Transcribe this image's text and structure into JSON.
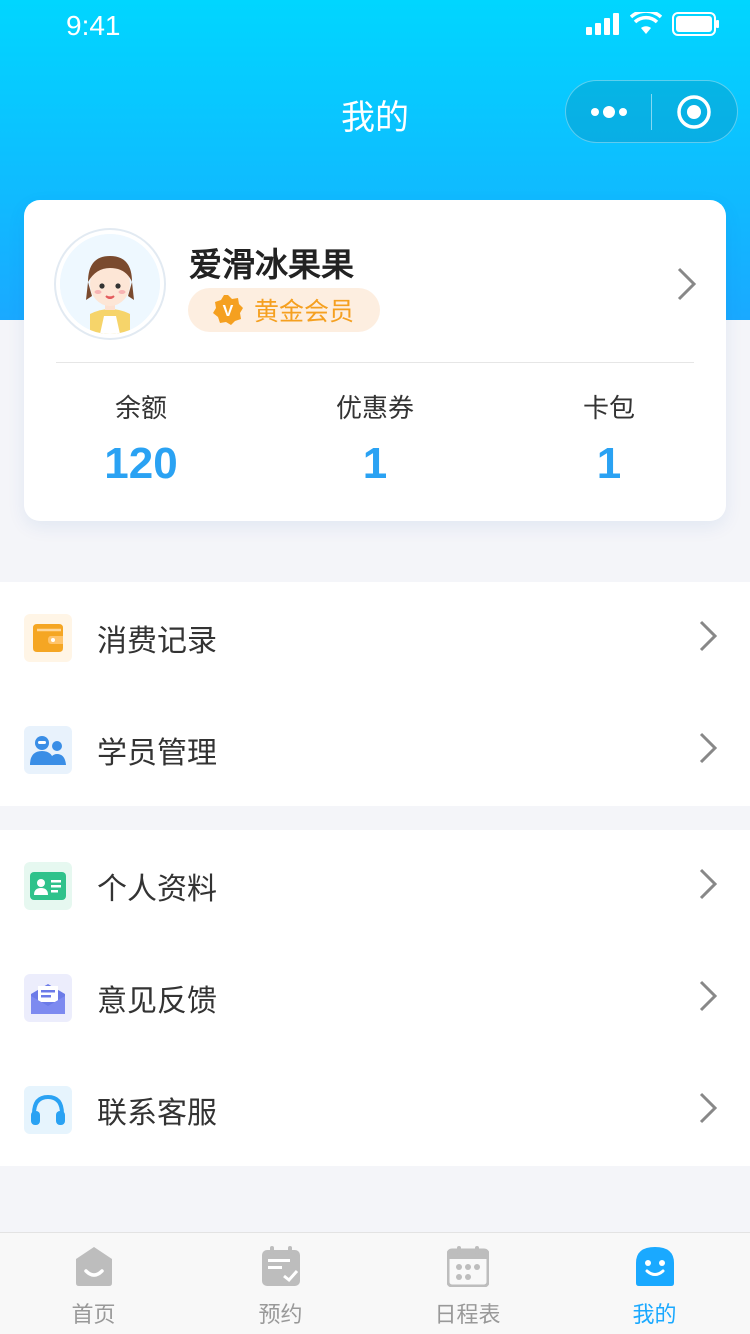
{
  "status_bar": {
    "time": "9:41"
  },
  "nav": {
    "title": "我的"
  },
  "profile": {
    "name": "爱滑冰果果",
    "vip_label": "黄金会员",
    "vip_mark": "V",
    "stats": [
      {
        "label": "余额",
        "value": "120"
      },
      {
        "label": "优惠券",
        "value": "1"
      },
      {
        "label": "卡包",
        "value": "1"
      }
    ]
  },
  "menu_group_1": [
    {
      "label": "消费记录",
      "icon": "wallet-icon",
      "color": "#f5a623"
    },
    {
      "label": "学员管理",
      "icon": "students-icon",
      "color": "#3a8ee6"
    }
  ],
  "menu_group_2": [
    {
      "label": "个人资料",
      "icon": "id-card-icon",
      "color": "#2fc28b"
    },
    {
      "label": "意见反馈",
      "icon": "feedback-mail-icon",
      "color": "#6c7be8"
    },
    {
      "label": "联系客服",
      "icon": "headset-icon",
      "color": "#2aa2f3"
    }
  ],
  "tabbar": [
    {
      "label": "首页",
      "icon": "home-icon",
      "active": false
    },
    {
      "label": "预约",
      "icon": "booking-icon",
      "active": false
    },
    {
      "label": "日程表",
      "icon": "calendar-icon",
      "active": false
    },
    {
      "label": "我的",
      "icon": "profile-face-icon",
      "active": true
    }
  ],
  "colors": {
    "accent": "#1aa9ff",
    "header_top": "#00d6ff",
    "stat_value": "#2aa2f3",
    "vip": "#f5a020"
  }
}
